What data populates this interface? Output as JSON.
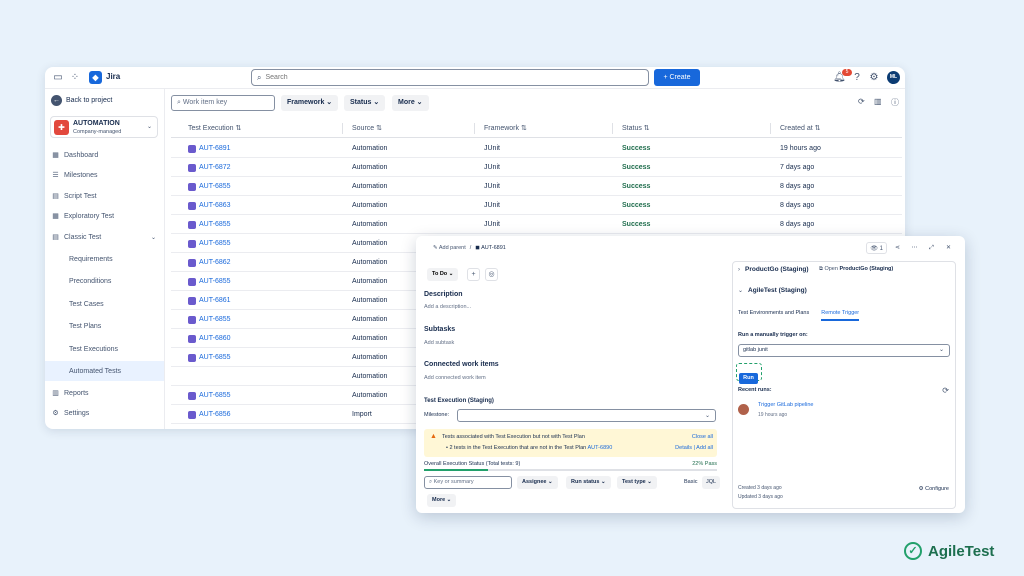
{
  "topbar": {
    "app_name": "Jira",
    "search_placeholder": "Search",
    "create_label": "+ Create",
    "notif_count": "5",
    "avatar_initials": "ML"
  },
  "sidebar": {
    "back_label": "Back to project",
    "project_name": "AUTOMATION",
    "project_type": "Company-managed",
    "items": {
      "dashboard": "Dashboard",
      "milestones": "Milestones",
      "script_test": "Script Test",
      "exploratory_test": "Exploratory Test",
      "classic_test": "Classic Test",
      "requirements": "Requirements",
      "preconditions": "Preconditions",
      "test_cases": "Test Cases",
      "test_plans": "Test Plans",
      "test_executions": "Test Executions",
      "automated_tests": "Automated Tests",
      "reports": "Reports",
      "settings": "Settings"
    }
  },
  "filters": {
    "work_item_placeholder": "Work item key",
    "framework": "Framework",
    "status": "Status",
    "more": "More"
  },
  "table": {
    "headers": {
      "test_execution": "Test Execution",
      "source": "Source",
      "framework": "Framework",
      "status": "Status",
      "created_at": "Created at"
    },
    "rows": [
      {
        "key": "AUT-6891",
        "source": "Automation",
        "framework": "JUnit",
        "status": "Success",
        "created": "19 hours ago"
      },
      {
        "key": "AUT-6872",
        "source": "Automation",
        "framework": "JUnit",
        "status": "Success",
        "created": "7 days ago"
      },
      {
        "key": "AUT-6855",
        "source": "Automation",
        "framework": "JUnit",
        "status": "Success",
        "created": "8 days ago"
      },
      {
        "key": "AUT-6863",
        "source": "Automation",
        "framework": "JUnit",
        "status": "Success",
        "created": "8 days ago"
      },
      {
        "key": "AUT-6855",
        "source": "Automation",
        "framework": "JUnit",
        "status": "Success",
        "created": "8 days ago"
      },
      {
        "key": "AUT-6855",
        "source": "Automation"
      },
      {
        "key": "AUT-6862",
        "source": "Automation"
      },
      {
        "key": "AUT-6855",
        "source": "Automation"
      },
      {
        "key": "AUT-6861",
        "source": "Automation"
      },
      {
        "key": "AUT-6855",
        "source": "Automation"
      },
      {
        "key": "AUT-6860",
        "source": "Automation"
      },
      {
        "key": "AUT-6855",
        "source": "Automation"
      },
      {
        "key": "",
        "source": "Automation"
      },
      {
        "key": "AUT-6855",
        "source": "Automation"
      },
      {
        "key": "AUT-6856",
        "source": "Import"
      }
    ]
  },
  "panel": {
    "add_parent": "Add parent",
    "crumb_sep": "/",
    "key": "AUT-6891",
    "watch_count": "1",
    "status_btn": "To Do",
    "description_title": "Description",
    "description_hint": "Add a description...",
    "subtasks_title": "Subtasks",
    "subtasks_hint": "Add subtask",
    "connected_title": "Connected work items",
    "connected_hint": "Add connected work item",
    "test_exec_title": "Test Execution (Staging)",
    "milestone_label": "Milestone:",
    "warning_line1": "Tests associated with Test Execution but not with Test Plan",
    "warning_line2": "2 tests in the Test Execution that are not in the Test Plan",
    "warning_plan": "AUT-6890",
    "close_all": "Close all",
    "details": "Details",
    "add_all": "Add all",
    "overall_status": "Overall Execution Status (Total tests: 9)",
    "pass_pct_label": "22% Pass",
    "pass_fraction": 0.22,
    "key_placeholder": "Key or summary",
    "assignee": "Assignee",
    "run_status": "Run status",
    "test_type": "Test type",
    "more": "More",
    "basic": "Basic",
    "jql": "JQL",
    "right": {
      "productgo": "ProductGo (Staging)",
      "open_label": "Open",
      "open_target": "ProductGo (Staging)",
      "agiletest": "AgileTest (Staging)",
      "tab_env": "Test Environments and Plans",
      "tab_remote": "Remote Trigger",
      "trigger_label": "Run a manually trigger on:",
      "trigger_value": "gitlab junit",
      "run_label": "Run",
      "recent_runs": "Recent runs:",
      "run_link": "Trigger GitLab pipeline",
      "run_time": "19 hours ago",
      "created": "Created 3 days ago",
      "updated": "Updated 3 days ago",
      "configure": "Configure"
    }
  },
  "brand": {
    "name": "AgileTest"
  }
}
